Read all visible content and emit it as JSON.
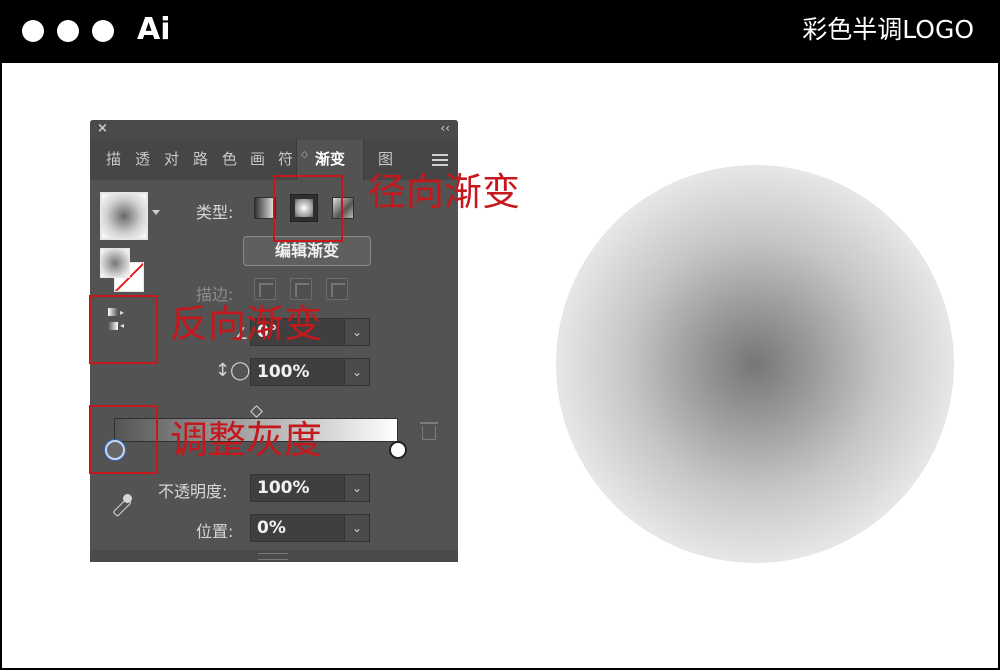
{
  "window": {
    "app_name": "Ai",
    "document_title": "彩色半调LOGO",
    "traffic_lights": [
      "dot",
      "dot",
      "dot"
    ]
  },
  "panel": {
    "close_icon": "×",
    "collapse_icon": "‹‹",
    "tabs": [
      "描",
      "透",
      "对",
      "路",
      "色",
      "画",
      "符"
    ],
    "active_tab": "渐变",
    "active_tab_arrows": "◇",
    "trailing_tab": "图",
    "type_label": "类型:",
    "edit_gradient_label": "编辑渐变",
    "stroke_label": "描边:",
    "angle": {
      "value": "0°",
      "icon": "angle-icon"
    },
    "aspect_ratio": {
      "value": "100%",
      "icon": "aspect-ratio-icon"
    },
    "opacity": {
      "label": "不透明度:",
      "value": "100%"
    },
    "location": {
      "label": "位置:",
      "value": "0%"
    },
    "dropdown_glyph": "⌄",
    "gradient_colors": {
      "start": "#555555",
      "end": "#ffffff"
    }
  },
  "annotations": {
    "radial": "径向渐变",
    "reverse": "反向渐变",
    "gray": "调整灰度",
    "color": "#c4181c"
  }
}
